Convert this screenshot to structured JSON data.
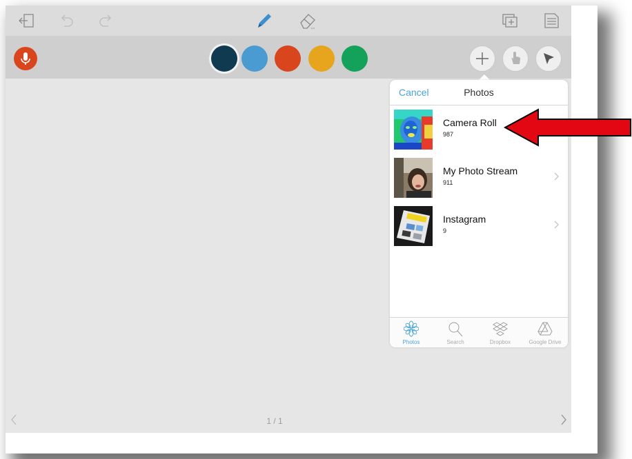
{
  "toolbar": {
    "icons": [
      "exit-icon",
      "undo-icon",
      "redo-icon",
      "pencil-icon",
      "eraser-icon",
      "add-page-icon",
      "notes-icon"
    ]
  },
  "colors": {
    "mic": "#d9461d",
    "swatches": [
      "#0f3a4f",
      "#4a9bd2",
      "#d9461d",
      "#e6a51c",
      "#14a25a"
    ],
    "accent": "#4aa3d9",
    "arrow": "#e30613"
  },
  "tools": {
    "icons": [
      "plus-icon",
      "hand-pointer-icon",
      "arrow-pointer-icon"
    ]
  },
  "popover": {
    "cancel_label": "Cancel",
    "title": "Photos",
    "albums": [
      {
        "title": "Camera Roll",
        "count": "987"
      },
      {
        "title": "My Photo Stream",
        "count": "911"
      },
      {
        "title": "Instagram",
        "count": "9"
      }
    ],
    "tabs": [
      {
        "label": "Photos",
        "icon": "flower-icon",
        "active": true
      },
      {
        "label": "Search",
        "icon": "magnifier-icon",
        "active": false
      },
      {
        "label": "Dropbox",
        "icon": "dropbox-icon",
        "active": false
      },
      {
        "label": "Google Drive",
        "icon": "google-drive-icon",
        "active": false
      }
    ]
  },
  "pager": {
    "text": "1 / 1"
  }
}
